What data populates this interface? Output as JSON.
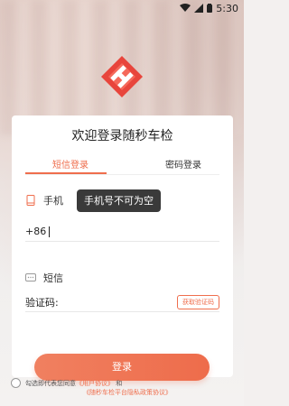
{
  "status_bar": {
    "time": "5:30",
    "icons": [
      "wifi-icon",
      "signal-icon",
      "battery-icon"
    ]
  },
  "logo": {
    "name": "app-logo",
    "color": "#e8453c"
  },
  "title": "欢迎登录随秒车检",
  "tabs": [
    {
      "label": "短信登录",
      "active": true
    },
    {
      "label": "密码登录",
      "active": false
    }
  ],
  "phone": {
    "label": "手机",
    "prefix": "+86"
  },
  "toast": "手机号不可为空",
  "sms": {
    "label": "短信",
    "code_label": "验证码:",
    "get_code_button": "获取验证码"
  },
  "login_button": "登录",
  "agreement": {
    "prefix": "勾选即代表您同意",
    "link1": "《用户协议》",
    "connector": "和",
    "link2": "《随秒车检平台隐私政策协议》"
  },
  "colors": {
    "accent": "#ef6e4d",
    "toast_bg": "#3a3a3a"
  }
}
